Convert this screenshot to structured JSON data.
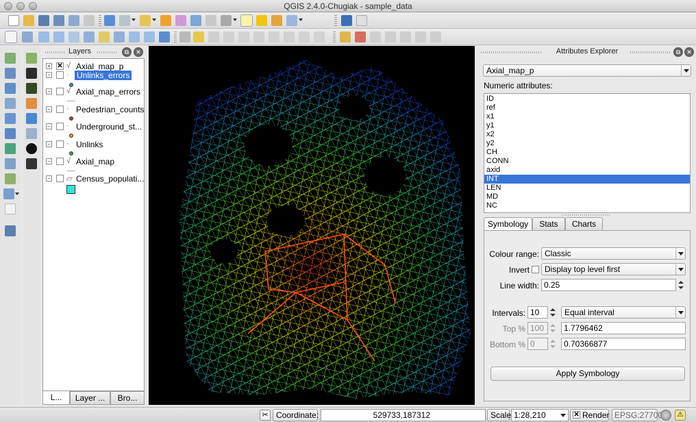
{
  "window": {
    "title": "QGIS 2.4.0-Chugiak - sample_data"
  },
  "layers_panel": {
    "title": "Layers",
    "layers": [
      {
        "name": "Axial_map_p",
        "checked": true,
        "expanded": false,
        "selected": false,
        "kind": "line"
      },
      {
        "name": "Unlinks_errors",
        "checked": false,
        "expanded": true,
        "selected": true,
        "kind": "point",
        "legend_color": "#2a9d8f"
      },
      {
        "name": "Axial_map_errors",
        "checked": false,
        "expanded": true,
        "selected": false,
        "kind": "line",
        "legend_color": "#b79dcc"
      },
      {
        "name": "Pedestrian_counts",
        "checked": false,
        "expanded": true,
        "selected": false,
        "kind": "point",
        "legend_color": "#c0392b"
      },
      {
        "name": "Underground_st...",
        "checked": false,
        "expanded": true,
        "selected": false,
        "kind": "point",
        "legend_color": "#d4a017"
      },
      {
        "name": "Unlinks",
        "checked": false,
        "expanded": true,
        "selected": false,
        "kind": "point",
        "legend_color": "#27ae60"
      },
      {
        "name": "Axial_map",
        "checked": false,
        "expanded": true,
        "selected": false,
        "kind": "line",
        "legend_color": "#b79dcc"
      },
      {
        "name": "Census_populati...",
        "checked": false,
        "expanded": true,
        "selected": false,
        "kind": "polygon",
        "legend_color": "#2ee6d6"
      }
    ],
    "bottom_tabs": [
      "L...",
      "Layer ...",
      "Bro..."
    ]
  },
  "attributes_explorer": {
    "title": "Attributes Explorer",
    "layer_select": "Axial_map_p",
    "numeric_label": "Numeric attributes:",
    "attributes": [
      "ID",
      "ref",
      "x1",
      "y1",
      "x2",
      "y2",
      "CH",
      "CONN",
      "axid",
      "INT",
      "LEN",
      "MD",
      "NC"
    ],
    "selected_attribute": "INT",
    "tabs": [
      "Symbology",
      "Stats",
      "Charts"
    ],
    "symbology": {
      "colour_range_label": "Colour range:",
      "colour_range_value": "Classic",
      "invert_label": "Invert",
      "display_order": "Display top level first",
      "line_width_label": "Line width:",
      "line_width_value": "0.25",
      "intervals_label": "Intervals:",
      "intervals_value": "10",
      "interval_mode": "Equal interval",
      "top_label": "Top %",
      "top_percent": "100",
      "top_value": "1.7796462",
      "bottom_label": "Bottom %",
      "bottom_percent": "0",
      "bottom_value": "0.70366877",
      "apply_label": "Apply Symbology"
    }
  },
  "statusbar": {
    "coordinate_label": "Coordinate:",
    "coordinate_value": "529733,187312",
    "scale_label": "Scale",
    "scale_value": "1:28,210",
    "render_label": "Render",
    "render_checked": true,
    "crs": "EPSG:27700"
  },
  "colors": {
    "selection": "#3875d7",
    "map_background": "#000000"
  }
}
